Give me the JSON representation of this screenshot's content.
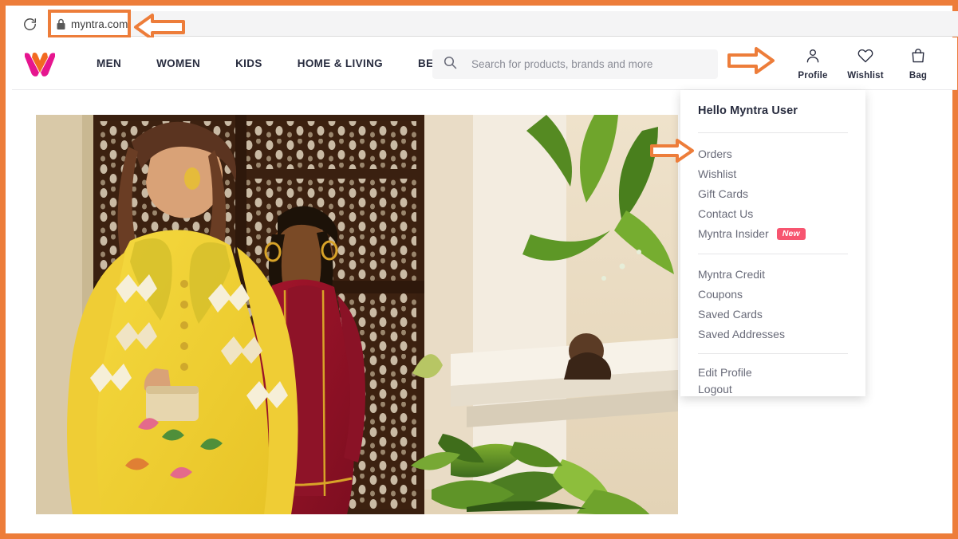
{
  "browser": {
    "reload_icon": "reload-icon",
    "lock_icon": "lock-icon",
    "url": "myntra.com"
  },
  "annotations": {
    "url_arrow": "arrow-pointing-left-at-url-bar",
    "profile_arrow": "arrow-pointing-right-at-profile-icon",
    "orders_arrow": "arrow-pointing-right-at-orders-item",
    "frame_color": "#ed7d3a"
  },
  "header": {
    "logo_alt": "myntra-logo",
    "nav": [
      {
        "label": "MEN"
      },
      {
        "label": "WOMEN"
      },
      {
        "label": "KIDS"
      },
      {
        "label": "HOME & LIVING"
      },
      {
        "label": "BEAUTY"
      }
    ],
    "search": {
      "icon": "search-icon",
      "placeholder": "Search for products, brands and more",
      "value": ""
    },
    "actions": [
      {
        "icon": "profile-icon",
        "label": "Profile"
      },
      {
        "icon": "heart-icon",
        "label": "Wishlist"
      },
      {
        "icon": "bag-icon",
        "label": "Bag"
      }
    ]
  },
  "profile_dropdown": {
    "greeting": "Hello Myntra User",
    "group_primary": [
      {
        "label": "Orders"
      },
      {
        "label": "Wishlist"
      },
      {
        "label": "Gift Cards"
      },
      {
        "label": "Contact Us"
      },
      {
        "label": "Myntra Insider",
        "badge": "New"
      }
    ],
    "group_account": [
      {
        "label": "Myntra Credit"
      },
      {
        "label": "Coupons"
      },
      {
        "label": "Saved Cards"
      },
      {
        "label": "Saved Addresses"
      }
    ],
    "group_footer": [
      {
        "label": "Edit Profile"
      },
      {
        "label": "Logout"
      }
    ],
    "badge_color": "#f75570"
  },
  "hero_banner": {
    "alt": "two-women-in-ethnic-wear-yellow-and-red-kurta-banner"
  }
}
